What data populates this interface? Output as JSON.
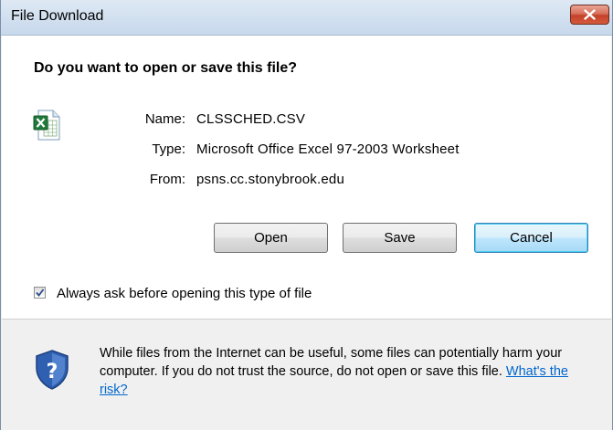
{
  "window": {
    "title": "File Download",
    "close_icon": "close-icon"
  },
  "prompt": {
    "heading": "Do you want to open or save this file?"
  },
  "file": {
    "icon": "excel-file-icon",
    "name_label": "Name:",
    "name_value": "CLSSCHED.CSV",
    "type_label": "Type:",
    "type_value": "Microsoft Office Excel 97-2003 Worksheet",
    "from_label": "From:",
    "from_value": "psns.cc.stonybrook.edu"
  },
  "buttons": {
    "open_label": "Open",
    "save_label": "Save",
    "cancel_label": "Cancel"
  },
  "options": {
    "always_ask_label": "Always ask before opening this type of file",
    "always_ask_checked": true
  },
  "footer": {
    "icon": "security-shield-icon",
    "warning_text": "While files from the Internet can be useful, some files can potentially harm your computer. If you do not trust the source, do not open or save this file.",
    "risk_link": "What's the risk?"
  },
  "colors": {
    "link": "#0066cc",
    "close_button": "#c4412a",
    "default_button_border": "#3c7fb1"
  }
}
